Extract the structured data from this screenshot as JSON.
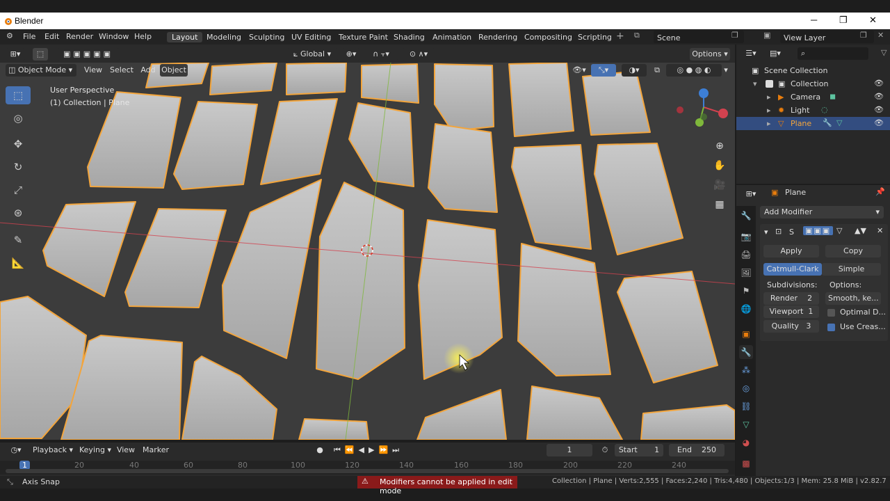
{
  "window": {
    "title": "Blender"
  },
  "menu": [
    "File",
    "Edit",
    "Render",
    "Window",
    "Help"
  ],
  "workspaces": [
    "Layout",
    "Modeling",
    "Sculpting",
    "UV Editing",
    "Texture Paint",
    "Shading",
    "Animation",
    "Rendering",
    "Compositing",
    "Scripting"
  ],
  "scene": "Scene",
  "view_layer": "View Layer",
  "header": {
    "transform_orientation": "Global",
    "options": "Options"
  },
  "viewport_header": {
    "mode": "Object Mode",
    "view": "View",
    "select": "Select",
    "add": "Add",
    "object": "Object"
  },
  "viewport": {
    "perspective": "User Perspective",
    "collection": "(1) Collection | Plane"
  },
  "outliner": {
    "items": [
      {
        "label": "Scene Collection"
      },
      {
        "label": "Collection"
      },
      {
        "label": "Camera"
      },
      {
        "label": "Light"
      },
      {
        "label": "Plane"
      }
    ]
  },
  "properties": {
    "object": "Plane",
    "add_modifier": "Add Modifier",
    "modifier_name": "S",
    "apply": "Apply",
    "copy": "Copy",
    "catmull": "Catmull-Clark",
    "simple": "Simple",
    "subdivisions_label": "Subdivisions:",
    "options_label": "Options:",
    "render": {
      "label": "Render",
      "value": "2"
    },
    "viewport": {
      "label": "Viewport",
      "value": "1"
    },
    "quality": {
      "label": "Quality",
      "value": "3"
    },
    "uv_smooth": "Smooth, ke...",
    "optimal": "Optimal D...",
    "use_crease": "Use Creas..."
  },
  "timeline": {
    "playback": "Playback",
    "keying": "Keying",
    "view": "View",
    "marker": "Marker",
    "current_frame": "1",
    "start_label": "Start",
    "start": "1",
    "end_label": "End",
    "end": "250",
    "ticks": [
      "1",
      "20",
      "40",
      "60",
      "80",
      "100",
      "120",
      "140",
      "160",
      "180",
      "200",
      "220",
      "240"
    ]
  },
  "status": {
    "left": "Axis Snap",
    "warning": "Modifiers cannot be applied in edit mode",
    "right": "Collection | Plane | Verts:2,555 | Faces:2,240 | Tris:4,480 | Objects:1/3 | Mem: 25.8 MiB | v2.82.7"
  },
  "colors": {
    "selection": "#f3a53c",
    "active_blue": "#4772b3",
    "x_axis": "#d3424f",
    "y_axis": "#7fb83b",
    "z_axis": "#3d7fd6",
    "warning_bg": "#8a1a1a"
  }
}
